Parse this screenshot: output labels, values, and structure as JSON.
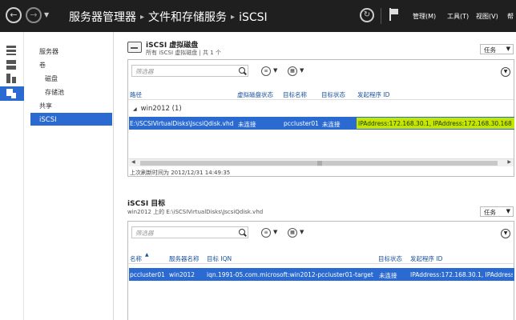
{
  "header": {
    "crumbs": [
      "服务器管理器",
      "文件和存储服务",
      "iSCSI"
    ],
    "menu": {
      "manage": "管理(M)",
      "tools": "工具(T)",
      "view": "视图(V)",
      "help": "帮"
    }
  },
  "nav": {
    "items": [
      {
        "label": "服务器"
      },
      {
        "label": "卷"
      },
      {
        "label": "磁盘"
      },
      {
        "label": "存储池"
      },
      {
        "label": "共享"
      },
      {
        "label": "iSCSI"
      }
    ]
  },
  "vdisk_panel": {
    "title": "iSCSI 虚拟磁盘",
    "subtitle": "所有 iSCSI 虚拟磁盘 | 共 1 个",
    "task_label": "任务",
    "filter_placeholder": "筛选器",
    "columns": [
      "路径",
      "虚拟磁盘状态",
      "目标名称",
      "目标状态",
      "发起程序 ID"
    ],
    "group_label": "win2012 (1)",
    "row": {
      "path": "E:\\iSCSIVirtualDisks\\JscsiQdisk.vhd",
      "disk_status": "未连接",
      "target_name": "pccluster01",
      "target_status": "未连接",
      "initiator_id": "IPAddress:172.168.30.1, IPAddress:172.168.30.168"
    },
    "footer": "上次刷新时间为 2012/12/31 14:49:35"
  },
  "target_panel": {
    "title": "iSCSI 目标",
    "subtitle": "win2012 上的 E:\\iSCSIVirtualDisks\\JscsiQdisk.vhd",
    "task_label": "任务",
    "filter_placeholder": "筛选器",
    "columns": [
      "名称",
      "服务器名称",
      "目标 IQN",
      "目标状态",
      "发起程序 ID"
    ],
    "row": {
      "name": "pccluster01",
      "server": "win2012",
      "iqn": "iqn.1991-05.com.microsoft:win2012-pccluster01-target",
      "status": "未连接",
      "initiator_id": "IPAddress:172.168.30.1, IPAddress:1"
    }
  },
  "colors": {
    "accent": "#2a6ad1",
    "highlight": "#c6e500",
    "header_bg": "#1f1f1f"
  }
}
